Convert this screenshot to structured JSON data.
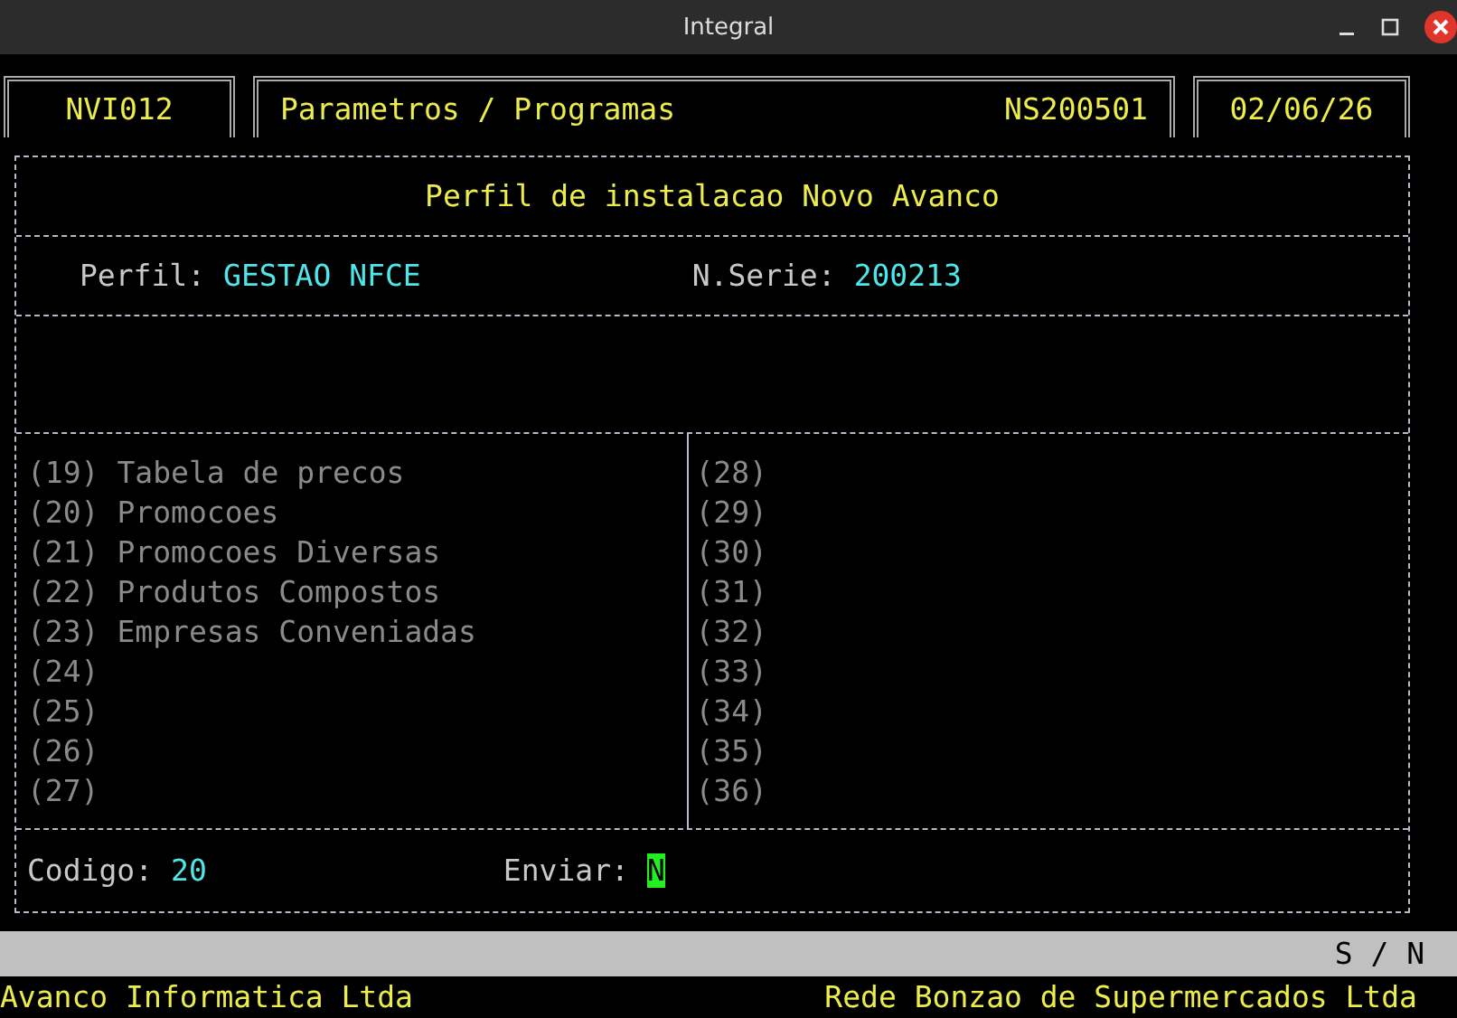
{
  "window": {
    "title": "Integral"
  },
  "header": {
    "program_code": "NVI012",
    "module": "Parametros / Programas",
    "serial": "NS200501",
    "date": "02/06/26"
  },
  "panel": {
    "title": "Perfil de instalacao Novo Avanco",
    "fields": [
      {
        "label": "Perfil:",
        "value": "GESTAO NFCE"
      },
      {
        "label": "N.Serie:",
        "value": "200213"
      }
    ]
  },
  "programs": {
    "columns": [
      [
        {
          "number": "(19)",
          "name": "Tabela de precos"
        },
        {
          "number": "(20)",
          "name": "Promocoes"
        },
        {
          "number": "(21)",
          "name": "Promocoes Diversas"
        },
        {
          "number": "(22)",
          "name": "Produtos Compostos"
        },
        {
          "number": "(23)",
          "name": "Empresas Conveniadas"
        },
        {
          "number": "(24)"
        },
        {
          "number": "(25)"
        },
        {
          "number": "(26)"
        },
        {
          "number": "(27)"
        }
      ],
      [
        {
          "number": "(28)"
        },
        {
          "number": "(29)"
        },
        {
          "number": "(30)"
        },
        {
          "number": "(31)"
        },
        {
          "number": "(32)"
        },
        {
          "number": "(33)"
        },
        {
          "number": "(34)"
        },
        {
          "number": "(35)"
        },
        {
          "number": "(36)"
        }
      ]
    ]
  },
  "form": {
    "codigo": {
      "label": "Codigo:",
      "value": "20"
    },
    "enviar": {
      "label": "Enviar:",
      "value": "N"
    }
  },
  "status_bar": {
    "hint": "S / N"
  },
  "footer": {
    "left": "Avanco Informatica Ltda",
    "right": "Rede Bonzao de Supermercados Ltda"
  }
}
